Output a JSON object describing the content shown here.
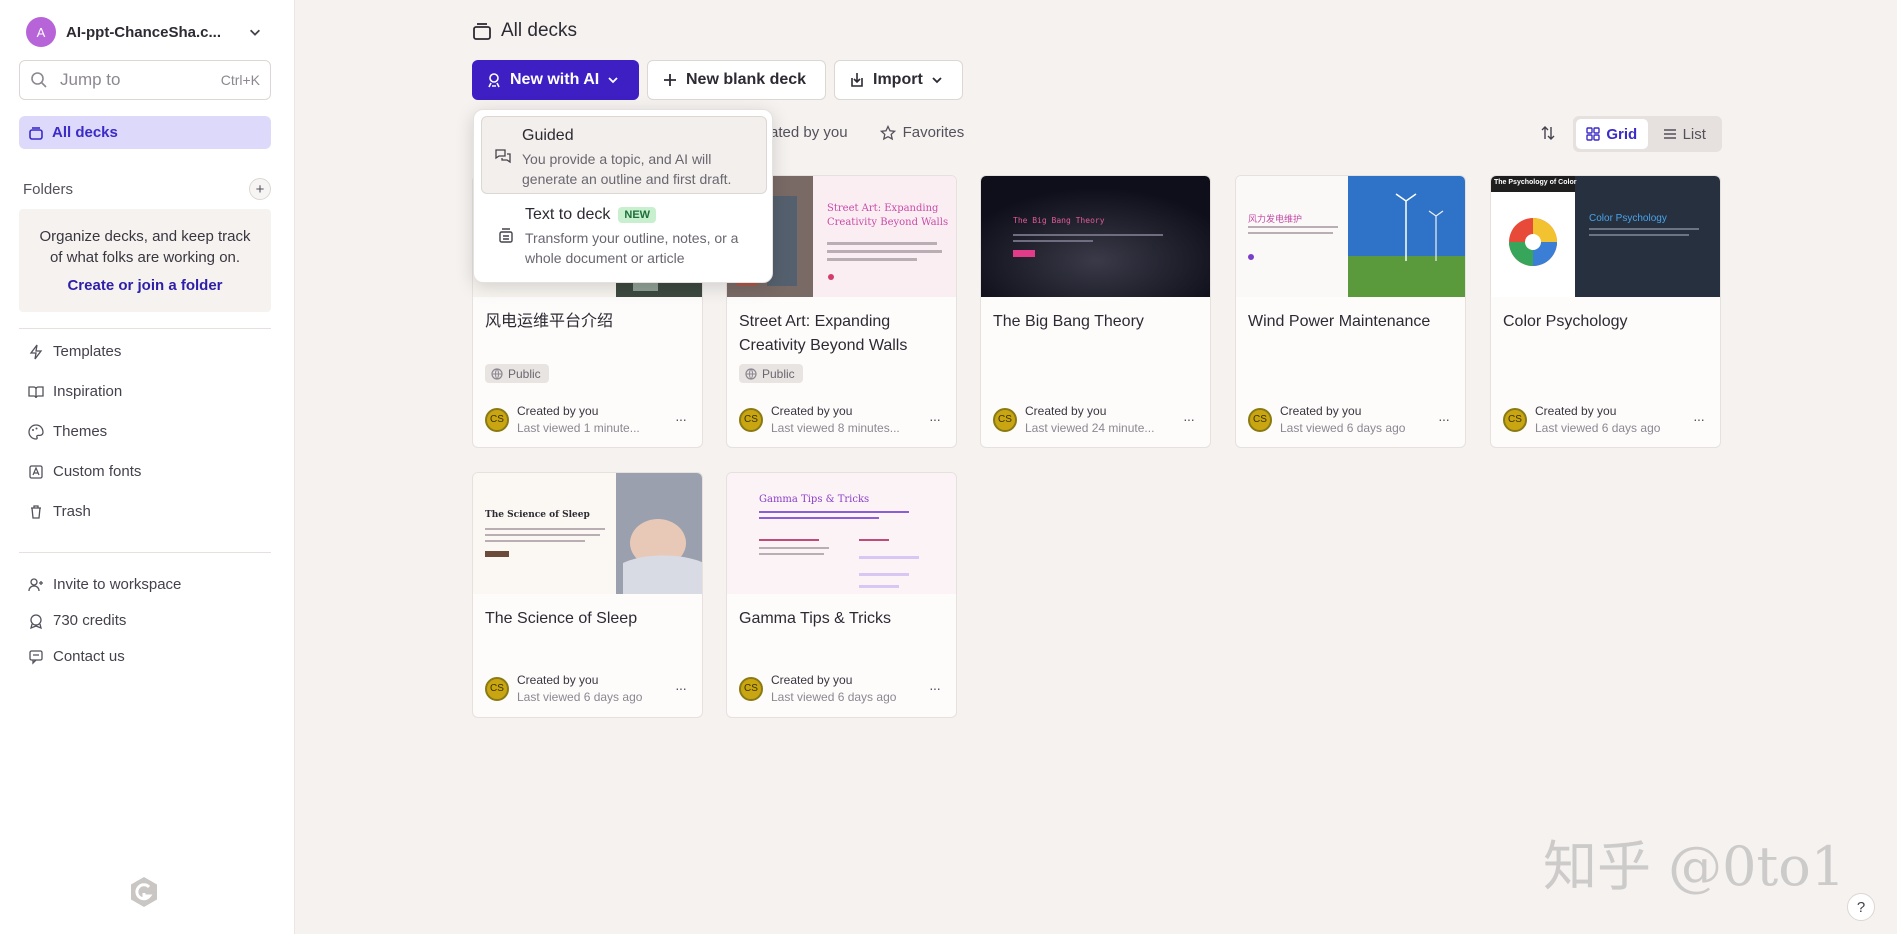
{
  "workspace": {
    "initial": "A",
    "name": "AI-ppt-ChanceSha.c..."
  },
  "search": {
    "placeholder": "Jump to",
    "shortcut": "Ctrl+K"
  },
  "sidebar": {
    "active_item": "All decks",
    "folders_label": "Folders",
    "folders_message": "Organize decks, and keep track of what folks are working on.",
    "folders_link": "Create or join a folder",
    "items": [
      {
        "label": "Templates",
        "icon": "templates-icon"
      },
      {
        "label": "Inspiration",
        "icon": "book-icon"
      },
      {
        "label": "Themes",
        "icon": "palette-icon"
      },
      {
        "label": "Custom fonts",
        "icon": "font-icon"
      },
      {
        "label": "Trash",
        "icon": "trash-icon"
      }
    ],
    "footer_items": [
      {
        "label": "Invite to workspace",
        "icon": "user-plus-icon"
      },
      {
        "label": "730 credits",
        "icon": "credits-icon"
      },
      {
        "label": "Contact us",
        "icon": "chat-icon"
      }
    ]
  },
  "header": {
    "title": "All decks"
  },
  "toolbar": {
    "new_ai": "New with AI",
    "new_blank": "New blank deck",
    "import": "Import"
  },
  "tabs": {
    "created_by_you": "ated by you",
    "favorites": "Favorites"
  },
  "view": {
    "grid": "Grid",
    "list": "List",
    "active": "Grid"
  },
  "dropdown": {
    "guided_title": "Guided",
    "guided_desc": "You provide a topic, and AI will generate an outline and first draft.",
    "text_title": "Text to deck",
    "text_badge": "NEW",
    "text_desc": "Transform your outline, notes, or a whole document or article"
  },
  "decks": [
    {
      "title": "风电运维平台介绍",
      "badge": "Public",
      "creator": "Created by you",
      "viewed": "Last viewed 1 minute...",
      "avatar": "CS"
    },
    {
      "title": "Street Art: Expanding Creativity Beyond Walls",
      "badge": "Public",
      "creator": "Created by you",
      "viewed": "Last viewed 8 minutes...",
      "avatar": "CS",
      "thumb_title": "Street Art: Expanding Creativity Beyond Walls"
    },
    {
      "title": "The Big Bang Theory",
      "creator": "Created by you",
      "viewed": "Last viewed 24 minute...",
      "avatar": "CS",
      "thumb_title": "The Big Bang Theory"
    },
    {
      "title": "Wind Power Maintenance",
      "creator": "Created by you",
      "viewed": "Last viewed 6 days ago",
      "avatar": "CS",
      "thumb_title": "风力发电维护"
    },
    {
      "title": "Color Psychology",
      "creator": "Created by you",
      "viewed": "Last viewed 6 days ago",
      "avatar": "CS",
      "thumb_title": "Color Psychology",
      "thumb_title_left": "The Psychology of Color"
    },
    {
      "title": "The Science of Sleep",
      "creator": "Created by you",
      "viewed": "Last viewed 6 days ago",
      "avatar": "CS",
      "thumb_title": "The Science of Sleep"
    },
    {
      "title": "Gamma Tips & Tricks",
      "creator": "Created by you",
      "viewed": "Last viewed 6 days ago",
      "avatar": "CS",
      "thumb_title": "Gamma Tips & Tricks"
    }
  ],
  "watermark": "知乎 @0to1",
  "help": "?"
}
